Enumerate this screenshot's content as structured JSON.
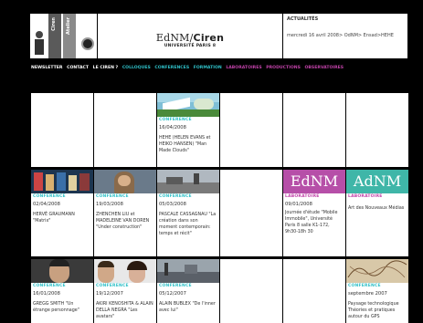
{
  "header": {
    "logo_lines": [
      "Ciren",
      "Atelier"
    ],
    "brand_main": "EdNM/",
    "brand_bold": "Ciren",
    "brand_sub": "UNIVERSITÉ PARIS 8",
    "news_title": "ACTUALITÉS",
    "news_text": "mercredi 16 avril 2008> OdNM> Ensad>HEHE"
  },
  "nav": [
    {
      "label": "NEWSLETTER",
      "color": "#ffffff"
    },
    {
      "label": "CONTACT",
      "color": "#ffffff"
    },
    {
      "label": "LE CIREN ?",
      "color": "#ffffff"
    },
    {
      "label": "COLLOQUES",
      "color": "#2fc0c8"
    },
    {
      "label": "CONFERENCES",
      "color": "#2fc0c8"
    },
    {
      "label": "FORMATION",
      "color": "#2fc0c8"
    },
    {
      "label": "LABORATOIRES",
      "color": "#c042a8"
    },
    {
      "label": "PRODUCTIONS",
      "color": "#c042a8"
    },
    {
      "label": "OBSERVATOIRES",
      "color": "#c042a8"
    }
  ],
  "colors": {
    "conference": "#2fc0c8",
    "laboratoire": "#c042a8",
    "ednm_tile": "#b64fa8",
    "adnm_tile": "#3fb6a8"
  },
  "cells": {
    "r1c3": {
      "category": "CONFERENCE",
      "date": "16/04/2008",
      "desc": "HEHE (HELEN EVANS et HEIKO HANSEN) \"Man Made Clouds\""
    },
    "r2c1": {
      "category": "CONFERENCE",
      "date": "02/04/2008",
      "desc": "HERVÉ GRAUMANN \"Matrix\""
    },
    "r2c2": {
      "category": "CONFERENCE",
      "date": "19/03/2008",
      "desc": "ZHENCHEN LIU et MADELEINE VAN DOREN \"Under construction\""
    },
    "r2c3": {
      "category": "CONFERENCE",
      "date": "05/03/2008",
      "desc": "PASCALE CASSAGNAU \"La création dans son moment contemporain: temps et récit\""
    },
    "r2c5": {
      "category": "LABORATOIRE",
      "date": "09/01/2008",
      "desc": "Journée d'étude \"Mobile Immobile\", Université Paris 8 salle K1-172, 9h30-18h 30",
      "tile": "EdNM"
    },
    "r2c6": {
      "category": "LABORATOIRE",
      "date": "",
      "desc": "Art des Nouveaux Médias",
      "tile": "AdNM"
    },
    "r3c1": {
      "category": "CONFERENCE",
      "date": "16/01/2008",
      "desc": "GREGG SMITH \"Un étrange personnage\""
    },
    "r3c2": {
      "category": "CONFERENCE",
      "date": "19/12/2007",
      "desc": "AKIRI KENOSHITA & ALAIN DELLA NEGRA \"Les avatars\""
    },
    "r3c3": {
      "category": "CONFERENCE",
      "date": "05/12/2007",
      "desc": "ALAIN BUBLEX \"De l'inner avec lui\""
    },
    "r3c6": {
      "category": "CONFERENCE",
      "date": "septembre 2007",
      "desc": "Paysage technologique Théories et pratiques autour du GPS"
    }
  }
}
